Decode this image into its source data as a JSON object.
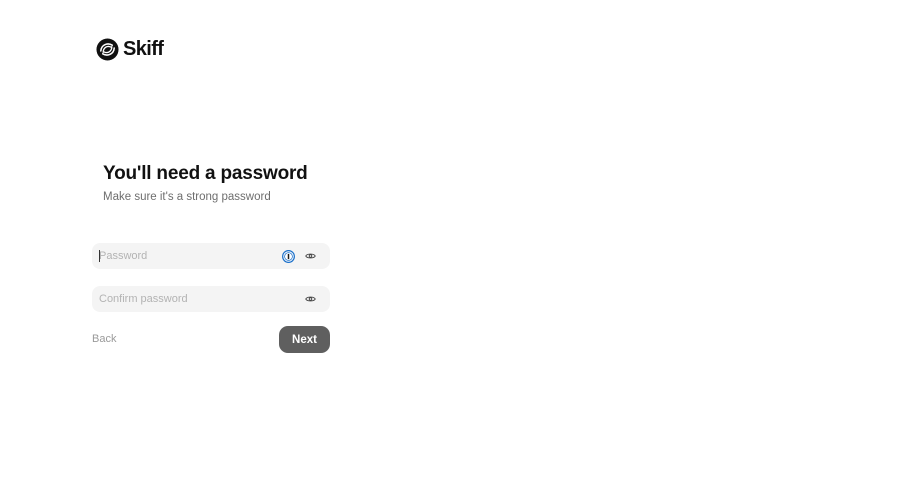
{
  "brand": {
    "name": "Skiff",
    "logo_icon": "skiff-logo-icon"
  },
  "heading": {
    "title": "You'll need a password",
    "subtitle": "Make sure it's a strong password"
  },
  "form": {
    "password": {
      "placeholder": "Password",
      "value": ""
    },
    "confirm_password": {
      "placeholder": "Confirm password",
      "value": ""
    }
  },
  "actions": {
    "back_label": "Back",
    "next_label": "Next"
  },
  "colors": {
    "input_bg": "#f4f4f4",
    "next_button_bg": "#5f5f5f",
    "password_manager_icon": "#1a6fc9"
  }
}
